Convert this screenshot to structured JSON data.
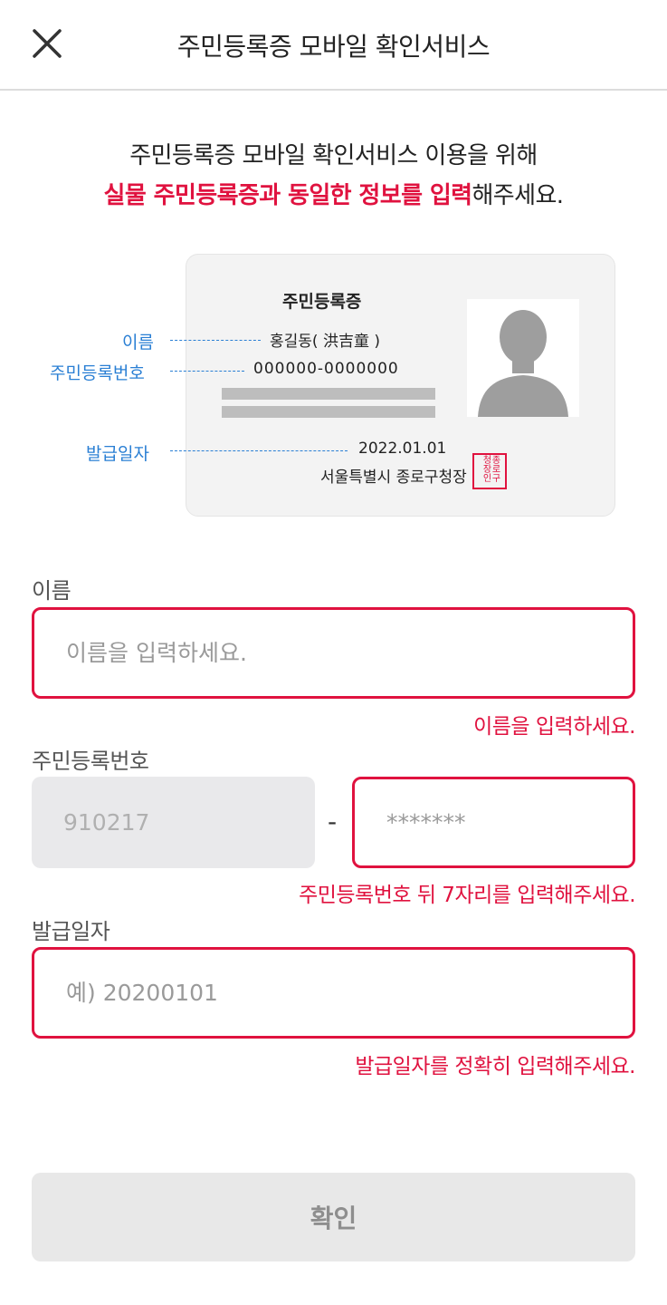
{
  "header": {
    "title": "주민등록증 모바일 확인서비스",
    "close_icon": "close-icon"
  },
  "intro": {
    "line1": "주민등록증 모바일 확인서비스 이용을 위해",
    "line2_highlight": "실물 주민등록증과 동일한 정보를 입력",
    "line2_rest": "해주세요."
  },
  "card": {
    "title": "주민등록증",
    "name": "홍길동( 洪吉童 )",
    "rrn": "000000-0000000",
    "issue_date": "2022.01.01",
    "issuer": "서울특별시 종로구청장",
    "seal_text": "종로구청장인",
    "photo_icon": "person-silhouette-icon",
    "guide_labels": {
      "name": "이름",
      "rrn": "주민등록번호",
      "issue_date": "발급일자"
    }
  },
  "form": {
    "name": {
      "label": "이름",
      "placeholder": "이름을 입력하세요.",
      "value": "",
      "error": "이름을 입력하세요."
    },
    "rrn": {
      "label": "주민등록번호",
      "front_value": "910217",
      "separator": "-",
      "back_placeholder": "*******",
      "error": "주민등록번호 뒤 7자리를 입력해주세요."
    },
    "issue_date": {
      "label": "발급일자",
      "placeholder": "예) 20200101",
      "value": "",
      "error": "발급일자를 정확히 입력해주세요."
    }
  },
  "confirm_button": {
    "label": "확인",
    "enabled": false
  },
  "colors": {
    "accent_red": "#e0123f",
    "guide_blue": "#2a7fd4",
    "disabled_bg": "#e8e8e8"
  }
}
